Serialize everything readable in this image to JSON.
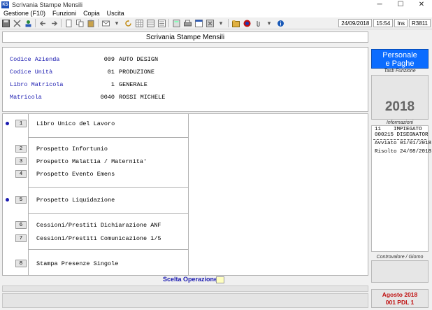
{
  "window": {
    "title": "Scrivania Stampe Mensili",
    "app_icon_label": "KS",
    "minimize": "─",
    "maximize": "☐",
    "close": "✕"
  },
  "menubar": {
    "items": [
      "Gestione (F10)",
      "Funzioni",
      "Copia",
      "Uscita"
    ]
  },
  "toolbar": {
    "status": {
      "date": "24/09/2018",
      "time": "15:54",
      "mode": "Ins",
      "terminal": "R3811"
    }
  },
  "header": {
    "title": "Scrivania Stampe Mensili"
  },
  "info": {
    "rows": [
      {
        "label": "Codice Azienda",
        "code": "009",
        "value": "AUTO DESIGN"
      },
      {
        "label": "Codice Unità",
        "code": "01",
        "value": "PRODUZIONE"
      },
      {
        "label": "Libro Matricola",
        "code": "1",
        "value": "GENERALE"
      },
      {
        "label": "Matricola",
        "code": "0040",
        "value": "ROSSI MICHELE"
      }
    ]
  },
  "options": [
    {
      "num": "1",
      "label": "Libro Unico del Lavoro",
      "marked": true
    },
    {
      "num": "2",
      "label": "Prospetto Infortunio",
      "marked": false
    },
    {
      "num": "3",
      "label": "Prospetto Malattia / Maternita'",
      "marked": false
    },
    {
      "num": "4",
      "label": "Prospetto Evento Emens",
      "marked": false
    },
    {
      "num": "5",
      "label": "Prospetto Liquidazione",
      "marked": true
    },
    {
      "num": "6",
      "label": "Cessioni/Prestiti Dichiarazione ANF",
      "marked": false
    },
    {
      "num": "7",
      "label": "Cessioni/Prestiti Comunicazione 1/5",
      "marked": false
    },
    {
      "num": "8",
      "label": "Stampa Presenze Singole",
      "marked": false
    }
  ],
  "scelta": {
    "label": "Scelta Operazione",
    "value": ""
  },
  "side": {
    "brand_line1": "Personale",
    "brand_line2": "e Paghe",
    "tasti_caption": "Tasti Funzione",
    "year": "2018",
    "informazioni_caption": "Informazioni",
    "emp_line1": "11    IMPIEGATO",
    "emp_line2": "000215 DISEGNATOR",
    "avviato": "Avviato 01/01/2018",
    "risolto": "Risolto 24/08/2018",
    "calendar_caption": "Controvalore / Giorno",
    "period_month": "Agosto  2018",
    "period_code": "001 PDL 1"
  }
}
